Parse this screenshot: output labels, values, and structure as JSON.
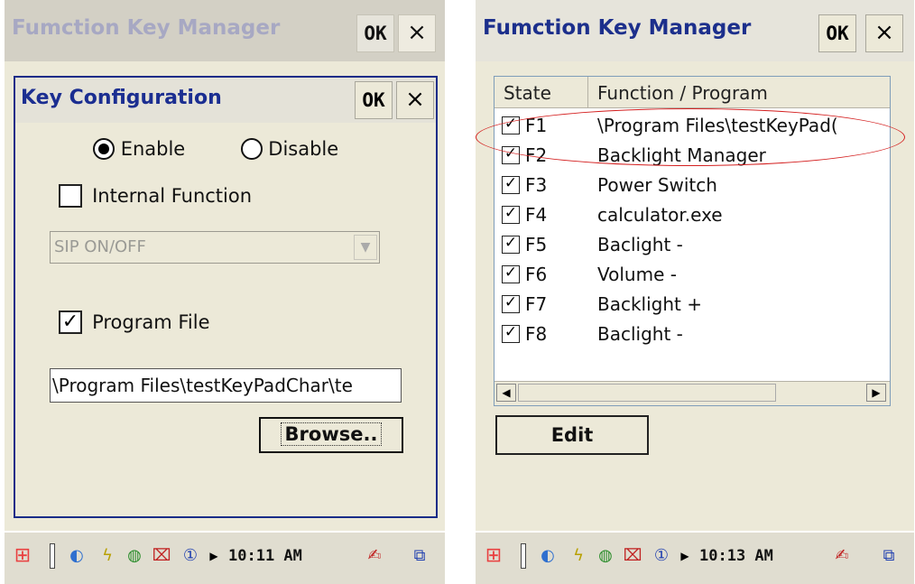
{
  "left": {
    "window_title": "Fumction Key Manager",
    "ok_label": "OK",
    "close_label": "×",
    "dialog": {
      "title": "Key Configuration",
      "ok_label": "OK",
      "close_label": "×",
      "enable_label": "Enable",
      "disable_label": "Disable",
      "enable_selected": true,
      "internal_function_label": "Internal Function",
      "internal_function_checked": false,
      "select_value": "SIP ON/OFF",
      "program_file_label": "Program File",
      "program_file_checked": true,
      "path_value": "\\Program Files\\testKeyPadChar\\te",
      "browse_label": "Browse.."
    },
    "taskbar": {
      "time": "10:11 AM"
    }
  },
  "right": {
    "window_title": "Fumction Key Manager",
    "ok_label": "OK",
    "close_label": "×",
    "list": {
      "col_state": "State",
      "col_function": "Function / Program",
      "rows": [
        {
          "key": "F1",
          "fn": "\\Program Files\\testKeyPad(",
          "checked": true
        },
        {
          "key": "F2",
          "fn": "Backlight Manager",
          "checked": true
        },
        {
          "key": "F3",
          "fn": "Power Switch",
          "checked": true
        },
        {
          "key": "F4",
          "fn": "calculator.exe",
          "checked": true
        },
        {
          "key": "F5",
          "fn": "Baclight -",
          "checked": true
        },
        {
          "key": "F6",
          "fn": "Volume -",
          "checked": true
        },
        {
          "key": "F7",
          "fn": "Backlight +",
          "checked": true
        },
        {
          "key": "F8",
          "fn": "Baclight -",
          "checked": true
        }
      ]
    },
    "edit_label": "Edit",
    "taskbar": {
      "time": "10:13 AM"
    }
  },
  "colors": {
    "title_blue": "#1b2e91",
    "highlight_red": "#d42020",
    "bg": "#ece9d8"
  },
  "icons": {
    "checkmark": "✓",
    "scroll_left": "◀",
    "scroll_right": "▶",
    "dropdown": "▼",
    "start": "⊞",
    "pen": "✍",
    "window": "⧉"
  }
}
